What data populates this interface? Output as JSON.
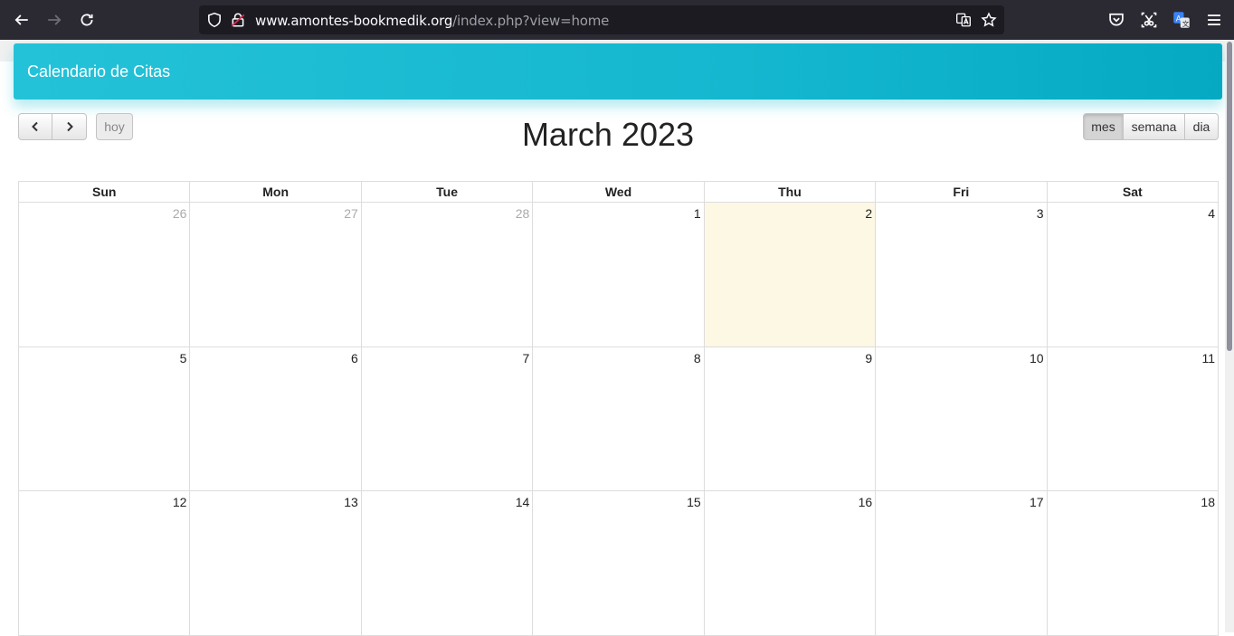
{
  "browser": {
    "url_host": "www.amontes-bookmedik.org",
    "url_path": "/index.php?view=home"
  },
  "header": {
    "title": "Calendario de Citas"
  },
  "toolbar": {
    "today_label": "hoy",
    "views": {
      "month": "mes",
      "week": "semana",
      "day": "dia"
    },
    "active_view": "mes"
  },
  "calendar": {
    "title": "March 2023",
    "weekdays": [
      "Sun",
      "Mon",
      "Tue",
      "Wed",
      "Thu",
      "Fri",
      "Sat"
    ],
    "weeks": [
      [
        {
          "n": "26",
          "other": true
        },
        {
          "n": "27",
          "other": true
        },
        {
          "n": "28",
          "other": true
        },
        {
          "n": "1"
        },
        {
          "n": "2",
          "today": true
        },
        {
          "n": "3"
        },
        {
          "n": "4"
        }
      ],
      [
        {
          "n": "5"
        },
        {
          "n": "6"
        },
        {
          "n": "7"
        },
        {
          "n": "8"
        },
        {
          "n": "9"
        },
        {
          "n": "10"
        },
        {
          "n": "11"
        }
      ],
      [
        {
          "n": "12"
        },
        {
          "n": "13"
        },
        {
          "n": "14"
        },
        {
          "n": "15"
        },
        {
          "n": "16"
        },
        {
          "n": "17"
        },
        {
          "n": "18"
        }
      ]
    ]
  },
  "colors": {
    "header_accent": "#24c2d8",
    "today_highlight": "#fcf8e3"
  }
}
